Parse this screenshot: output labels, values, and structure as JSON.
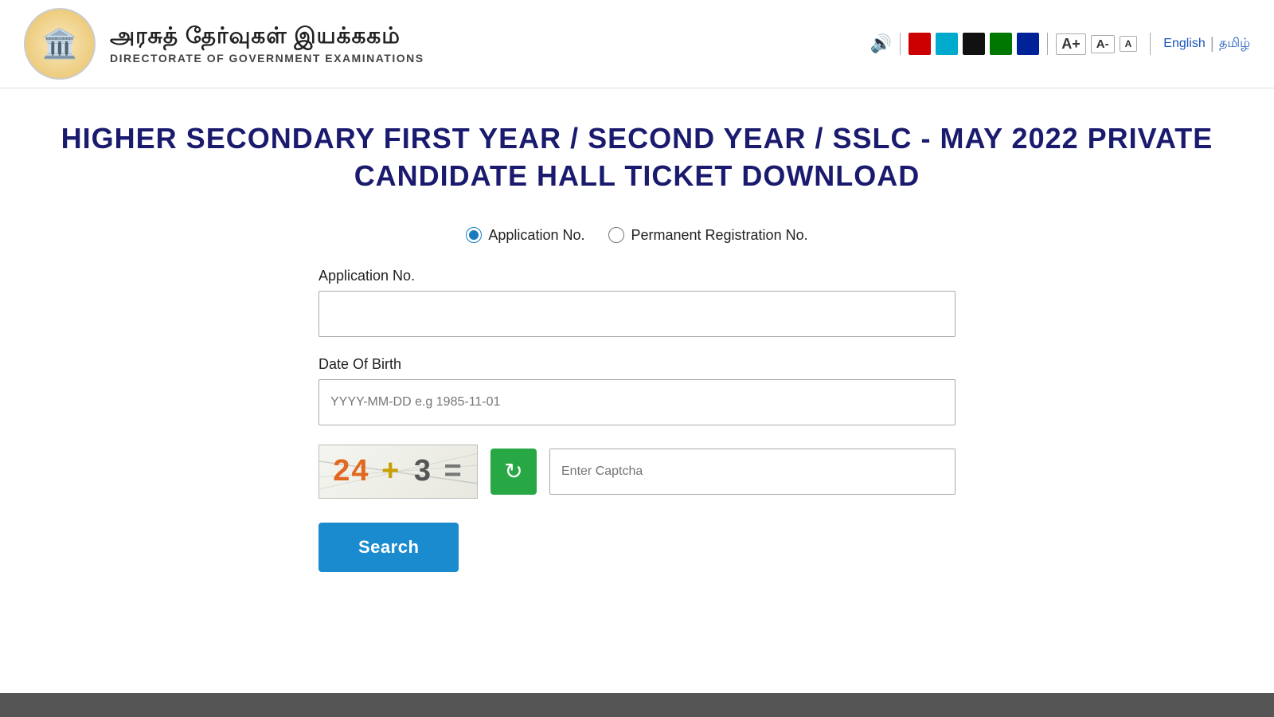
{
  "header": {
    "logo_symbol": "🏛️",
    "title_tamil": "அரசுத் தேர்வுகள் இயக்ககம்",
    "title_english": "DIRECTORATE OF GOVERNMENT EXAMINATIONS",
    "accessibility": {
      "speaker_icon": "🔊",
      "colors": [
        {
          "name": "red",
          "hex": "#cc0000"
        },
        {
          "name": "cyan",
          "hex": "#00aacc"
        },
        {
          "name": "black",
          "hex": "#111111"
        },
        {
          "name": "green",
          "hex": "#007700"
        },
        {
          "name": "dark-blue",
          "hex": "#002299"
        }
      ],
      "font_large": "A+",
      "font_medium": "A-",
      "font_small": "A"
    },
    "lang_english": "English",
    "lang_tamil": "தமிழ்"
  },
  "page": {
    "title_line1": "HIGHER SECONDARY FIRST YEAR / SECOND YEAR / SSLC - MAY 2022 PRIVATE",
    "title_line2": "CANDIDATE HALL TICKET DOWNLOAD"
  },
  "form": {
    "radio1_label": "Application No.",
    "radio2_label": "Permanent Registration No.",
    "field1_label": "Application No.",
    "field1_placeholder": "",
    "field2_label": "Date Of Birth",
    "field2_placeholder": "YYYY-MM-DD e.g 1985-11-01",
    "captcha_num1": "24",
    "captcha_op": "+",
    "captcha_num2": "3",
    "captcha_eq": "=",
    "captcha_placeholder": "Enter Captcha",
    "search_label": "Search"
  }
}
